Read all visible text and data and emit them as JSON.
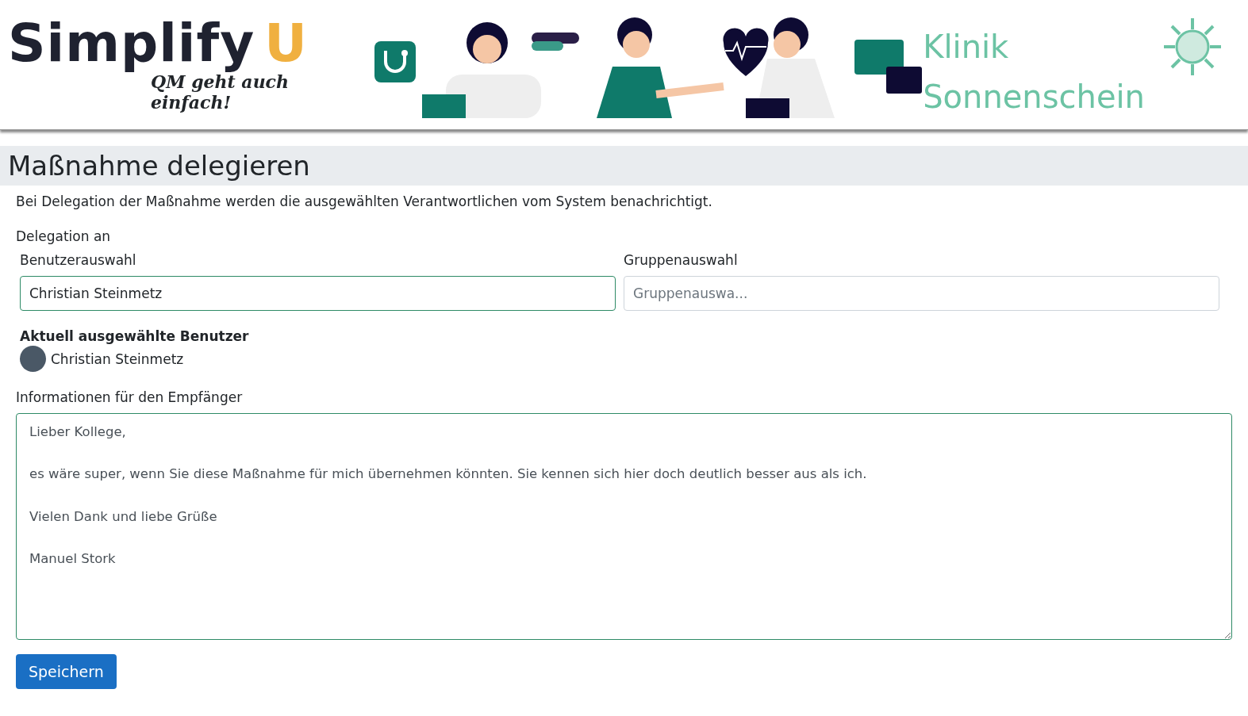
{
  "header": {
    "logo": {
      "word": "Simplify",
      "letter": "U",
      "tagline": "QM geht auch einfach!"
    },
    "clinic": {
      "line_1": "Klinik",
      "line_2": "Sonnenschein"
    }
  },
  "page_title": "Maßnahme delegieren",
  "intro": "Bei Delegation der Maßnahme werden die ausgewählten Verantwortlichen vom System benachrichtigt.",
  "delegation_label": "Delegation an",
  "user_field": {
    "label": "Benutzerauswahl",
    "value": "Christian Steinmetz",
    "focused": true
  },
  "group_field": {
    "label": "Gruppenauswahl",
    "placeholder": "Gruppenauswa..."
  },
  "selected_users": {
    "title": "Aktuell ausgewählte Benutzer",
    "users": [
      {
        "name": "Christian Steinmetz"
      }
    ]
  },
  "message": {
    "label": "Informationen für den Empfänger",
    "value": "Lieber Kollege,\n\nes wäre super, wenn Sie diese Maßnahme für mich übernehmen könnten. Sie kennen sich hier doch deutlich besser aus als ich.\n\nVielen Dank und liebe Grüße\n\nManuel Stork"
  },
  "save_button": "Speichern"
}
